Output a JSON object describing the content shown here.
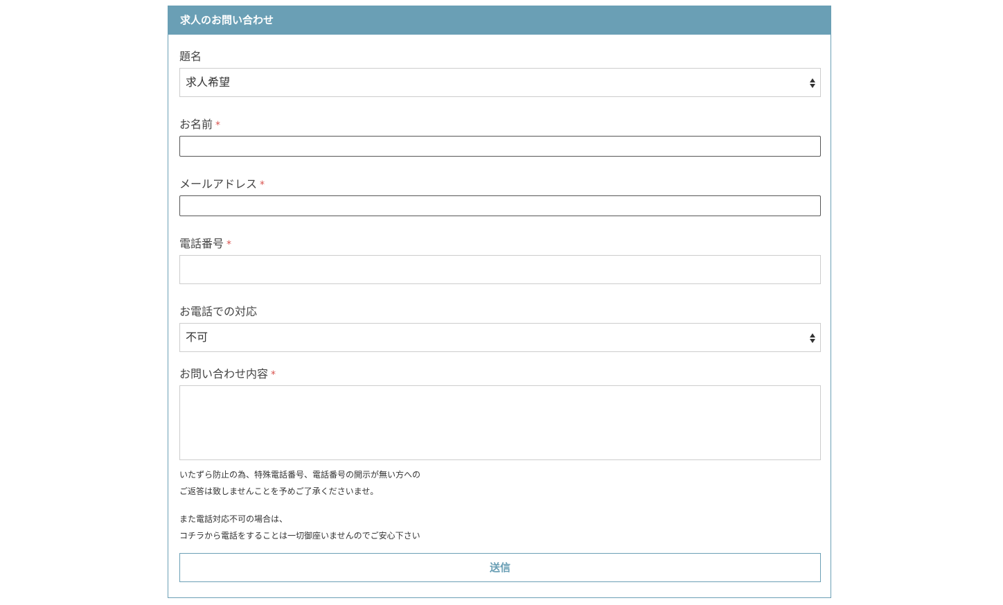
{
  "form": {
    "title": "求人のお問い合わせ",
    "required_mark": "*",
    "subject": {
      "label": "題名",
      "selected": "求人希望"
    },
    "name": {
      "label": "お名前",
      "value": ""
    },
    "email": {
      "label": "メールアドレス",
      "value": ""
    },
    "phone": {
      "label": "電話番号",
      "value": ""
    },
    "phone_contact": {
      "label": "お電話での対応",
      "selected": "不可"
    },
    "message": {
      "label": "お問い合わせ内容",
      "value": ""
    },
    "notes": [
      "いたずら防止の為、特殊電話番号、電話番号の開示が無い方への",
      "ご返答は致しませんことを予めご了承くださいませ。",
      "また電話対応不可の場合は、",
      "コチラから電話をすることは一切御座いませんのでご安心下さい"
    ],
    "submit_label": "送信"
  },
  "colors": {
    "accent": "#6a9fb5",
    "required": "#d9534f"
  },
  "icons": {
    "select_arrows": "updown-arrows-icon"
  }
}
